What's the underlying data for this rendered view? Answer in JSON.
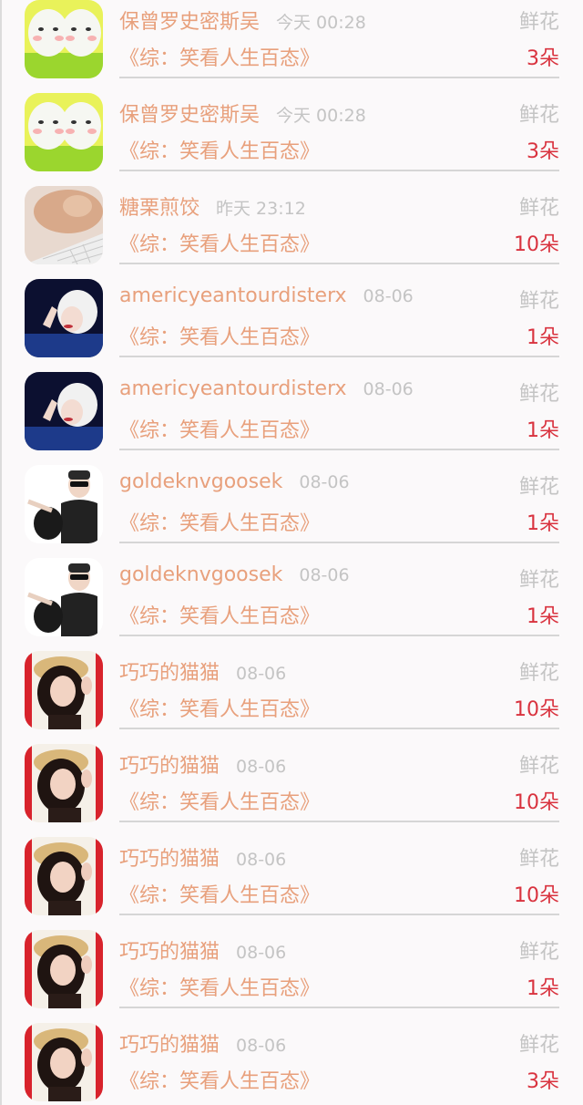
{
  "gift_label": "鲜花",
  "rows": [
    {
      "name": "保曾罗史密斯吴",
      "time": "今天 00:28",
      "book": "《综：笑看人生百态》",
      "count": "3朵",
      "avatar": "eggs-avatar-icon"
    },
    {
      "name": "保曾罗史密斯吴",
      "time": "今天 00:28",
      "book": "《综：笑看人生百态》",
      "count": "3朵",
      "avatar": "eggs-avatar-icon"
    },
    {
      "name": "糖栗煎饺",
      "time": "昨天 23:12",
      "book": "《综：笑看人生百态》",
      "count": "10朵",
      "avatar": "cat-keyboard-avatar-icon"
    },
    {
      "name": "americyeantourdisterx",
      "time": "08-06",
      "book": "《综：笑看人生百态》",
      "count": "1朵",
      "avatar": "blonde-woman-avatar-icon"
    },
    {
      "name": "americyeantourdisterx",
      "time": "08-06",
      "book": "《综：笑看人生百态》",
      "count": "1朵",
      "avatar": "blonde-woman-avatar-icon"
    },
    {
      "name": "goldeknvgoosek",
      "time": "08-06",
      "book": "《综：笑看人生百态》",
      "count": "1朵",
      "avatar": "man-sunglasses-avatar-icon"
    },
    {
      "name": "goldeknvgoosek",
      "time": "08-06",
      "book": "《综：笑看人生百态》",
      "count": "1朵",
      "avatar": "man-sunglasses-avatar-icon"
    },
    {
      "name": "巧巧的猫猫",
      "time": "08-06",
      "book": "《综：笑看人生百态》",
      "count": "10朵",
      "avatar": "woman-hat-avatar-icon"
    },
    {
      "name": "巧巧的猫猫",
      "time": "08-06",
      "book": "《综：笑看人生百态》",
      "count": "10朵",
      "avatar": "woman-hat-avatar-icon"
    },
    {
      "name": "巧巧的猫猫",
      "time": "08-06",
      "book": "《综：笑看人生百态》",
      "count": "10朵",
      "avatar": "woman-hat-avatar-icon"
    },
    {
      "name": "巧巧的猫猫",
      "time": "08-06",
      "book": "《综：笑看人生百态》",
      "count": "1朵",
      "avatar": "woman-hat-avatar-icon"
    },
    {
      "name": "巧巧的猫猫",
      "time": "08-06",
      "book": "《综：笑看人生百态》",
      "count": "3朵",
      "avatar": "woman-hat-avatar-icon"
    }
  ],
  "colors": {
    "name": "#e8a07c",
    "book": "#e8a07c",
    "meta": "#c4c4c4",
    "count": "#d9333f",
    "divider": "#d6d6d6"
  }
}
